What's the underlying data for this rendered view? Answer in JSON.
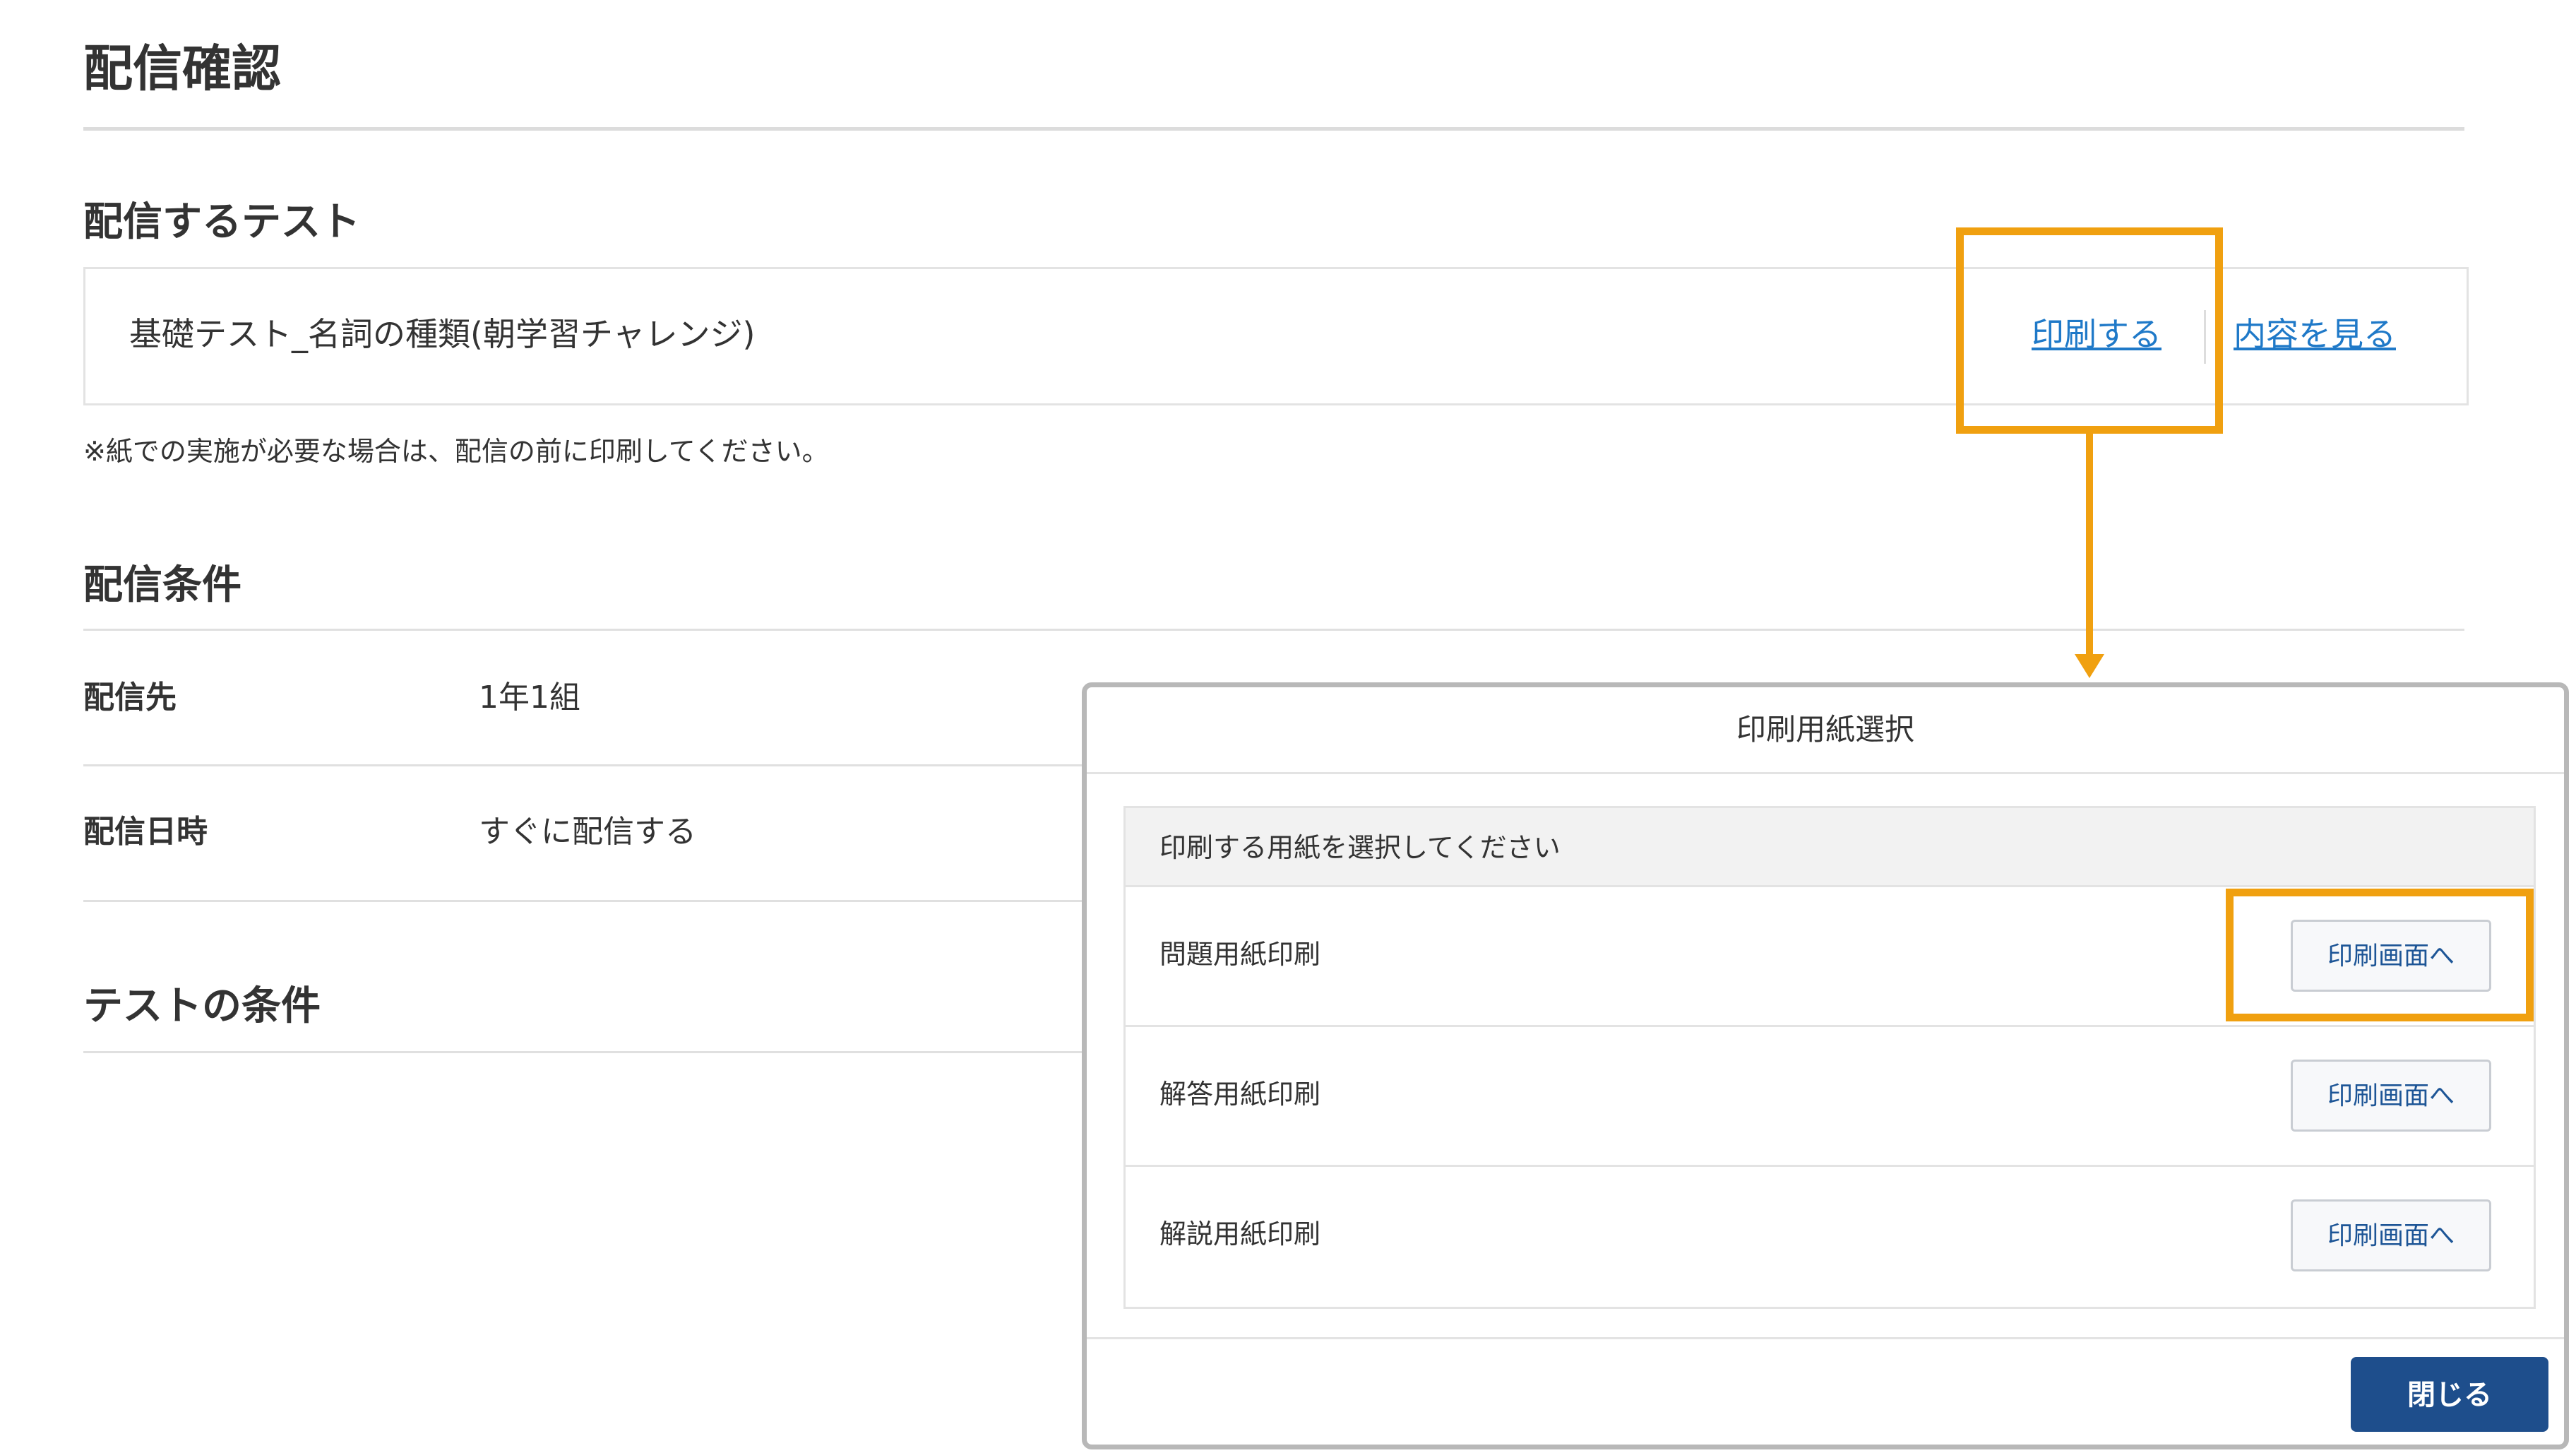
{
  "page": {
    "title": "配信確認"
  },
  "test_section": {
    "heading": "配信するテスト",
    "test_name": "基礎テスト_名詞の種類(朝学習チャレンジ)",
    "print_link": "印刷する",
    "view_link": "内容を見る",
    "note": "※紙での実施が必要な場合は、配信の前に印刷してください。"
  },
  "conditions": {
    "heading": "配信条件",
    "rows": [
      {
        "label": "配信先",
        "value": "1年1組"
      },
      {
        "label": "配信日時",
        "value": "すぐに配信する"
      }
    ]
  },
  "test_conditions": {
    "heading": "テストの条件"
  },
  "modal": {
    "title": "印刷用紙選択",
    "instruction": "印刷する用紙を選択してください",
    "options": [
      {
        "label": "問題用紙印刷",
        "button": "印刷画面へ"
      },
      {
        "label": "解答用紙印刷",
        "button": "印刷画面へ"
      },
      {
        "label": "解説用紙印刷",
        "button": "印刷画面へ"
      }
    ],
    "close_label": "閉じる"
  },
  "colors": {
    "highlight": "#f0a010",
    "link": "#1f79c8",
    "primary_button": "#1e4e8c"
  },
  "icons": {
    "arrow": "arrow-down-icon"
  }
}
